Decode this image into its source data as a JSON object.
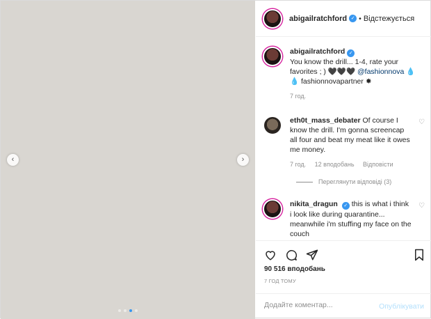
{
  "post": {
    "username": "abigailratchford",
    "follow_status": "Відстежується",
    "media_placeholder_text": "",
    "carousel": {
      "count": 4,
      "active_index": 2
    }
  },
  "caption": {
    "username": "abigailratchford",
    "text": "You know the drill... 1-4, rate your favorites ; ) 🖤🖤🖤",
    "mention": "@fashionnova",
    "tag": "fashionnovapartner",
    "age": "7 год."
  },
  "comments": [
    {
      "username": "eth0t_mass_debater",
      "text": "Of course I know the drill. I'm gonna screencap all four and beat my meat like it owes me money.",
      "age": "7 год.",
      "likes": "12 вподобань",
      "reply_label": "Відповісти",
      "view_replies": "Переглянути відповіді (3)"
    },
    {
      "username": "nikita_dragun",
      "text": "this is what i think i look like during quarantine... meanwhile i'm stuffing my face on the couch"
    }
  ],
  "engagement": {
    "likes": "90 516 вподобань",
    "timestamp": "7 ГОД ТОМУ"
  },
  "comment_box": {
    "placeholder": "Додайте коментар...",
    "publish_label": "Опублікувати"
  }
}
